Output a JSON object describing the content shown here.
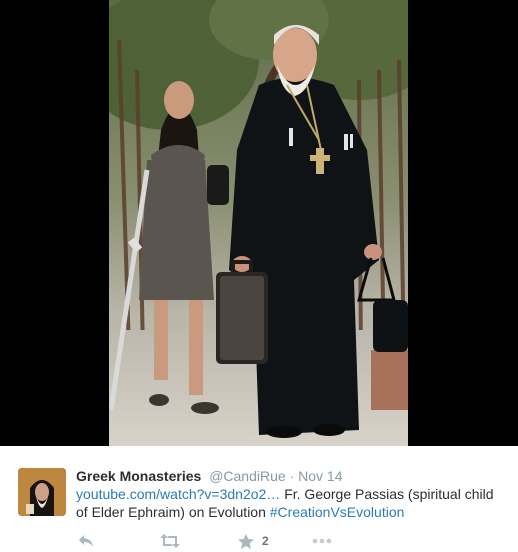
{
  "media": {
    "icon": "photo",
    "background": "#000000"
  },
  "tweet": {
    "fullname": "Greek Monasteries",
    "handle": "@CandiRue",
    "separator": "·",
    "time": "Nov 14",
    "link_text": "youtube.com/watch?v=3dn2o2…",
    "body_text": " Fr. George Passias (spiritual child of Elder Ephraim) on Evolution ",
    "hashtag": "#CreationVsEvolution",
    "favorite_count": "2"
  },
  "actions": {
    "reply_icon": "reply-icon",
    "retweet_icon": "retweet-icon",
    "favorite_icon": "star-icon",
    "more_icon": "more-icon"
  },
  "colors": {
    "link": "#2b7bb9",
    "action_grey": "#aab8c2",
    "meta_grey": "#8899a6"
  }
}
